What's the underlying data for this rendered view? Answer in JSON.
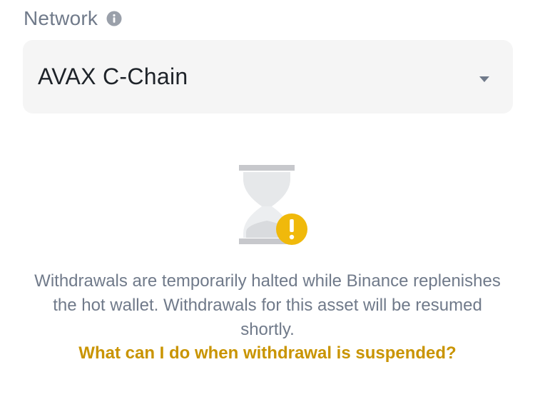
{
  "network": {
    "label": "Network",
    "info_icon": "info-icon",
    "selected": "AVAX C-Chain",
    "dropdown_icon": "caret-down-icon"
  },
  "status": {
    "icon": "hourglass-warning-icon",
    "message": "Withdrawals are temporarily halted while Binance replenishes\nthe hot wallet. Withdrawals for this asset will be resumed\nshortly.",
    "help_link": "What can I do when withdrawal is suspended?"
  },
  "colors": {
    "label": "#707a8a",
    "field_bg": "#f5f5f5",
    "value_text": "#1e2329",
    "link": "#c99400",
    "warning": "#f0b90b",
    "icon_gray": "#c7c8cc"
  }
}
